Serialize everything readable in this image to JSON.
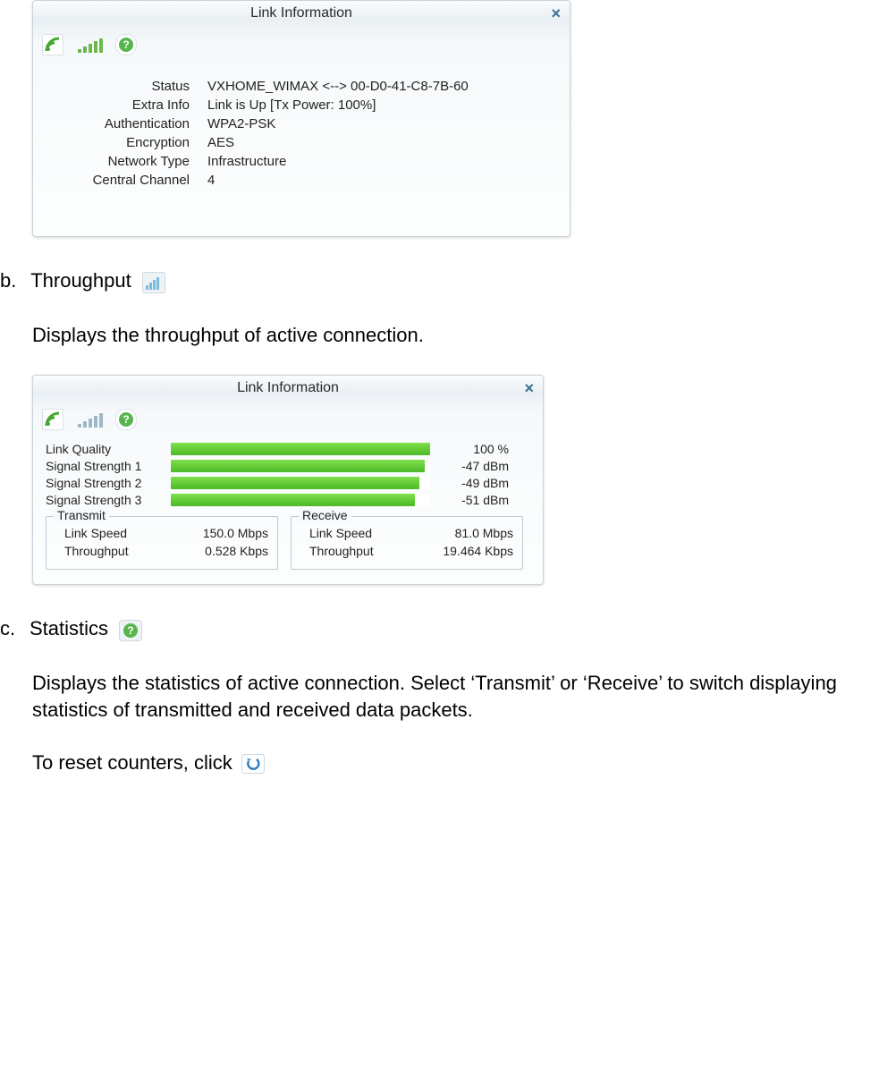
{
  "panel1": {
    "title": "Link Information",
    "rows": [
      {
        "label": "Status",
        "value": "VXHOME_WIMAX <--> 00-D0-41-C8-7B-60"
      },
      {
        "label": "Extra Info",
        "value": "Link is Up  [Tx Power: 100%]"
      },
      {
        "label": "Authentication",
        "value": "WPA2-PSK"
      },
      {
        "label": "Encryption",
        "value": "AES"
      },
      {
        "label": "Network Type",
        "value": "Infrastructure"
      },
      {
        "label": "Central Channel",
        "value": "4"
      }
    ]
  },
  "section_b": {
    "marker": "b.",
    "title": "Throughput",
    "desc": "Displays the throughput of active connection."
  },
  "panel2": {
    "title": "Link Information",
    "bars": [
      {
        "label": "Link Quality",
        "pct": 100,
        "value": "100 %"
      },
      {
        "label": "Signal Strength 1",
        "pct": 98,
        "value": "-47 dBm"
      },
      {
        "label": "Signal Strength 2",
        "pct": 96,
        "value": "-49 dBm"
      },
      {
        "label": "Signal Strength 3",
        "pct": 94,
        "value": "-51 dBm"
      }
    ],
    "transmit": {
      "legend": "Transmit",
      "link_speed_label": "Link Speed",
      "link_speed": "150.0 Mbps",
      "throughput_label": "Throughput",
      "throughput": "0.528 Kbps"
    },
    "receive": {
      "legend": "Receive",
      "link_speed_label": "Link Speed",
      "link_speed": "81.0 Mbps",
      "throughput_label": "Throughput",
      "throughput": "19.464 Kbps"
    }
  },
  "section_c": {
    "marker": "c.",
    "title": "Statistics",
    "desc": "Displays the statistics of active connection. Select ‘Transmit’ or ‘Receive’ to switch displaying statistics of transmitted and received data packets.",
    "reset_text": "To reset counters, click"
  },
  "chart_data": {
    "type": "bar",
    "title": "Link Information signal bars",
    "categories": [
      "Link Quality",
      "Signal Strength 1",
      "Signal Strength 2",
      "Signal Strength 3"
    ],
    "values_label": [
      "100 %",
      "-47 dBm",
      "-49 dBm",
      "-51 dBm"
    ],
    "values_pct_of_full": [
      100,
      98,
      96,
      94
    ],
    "orientation": "horizontal",
    "xlim": [
      0,
      100
    ]
  }
}
